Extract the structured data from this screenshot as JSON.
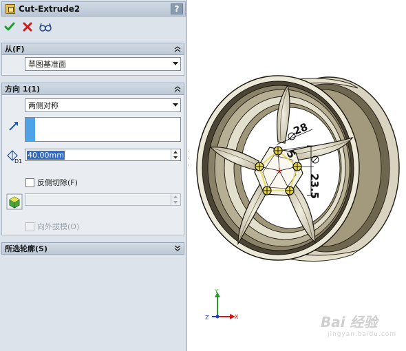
{
  "feature": {
    "title": "Cut-Extrude2",
    "help_label": "?"
  },
  "actions": [
    {
      "name": "ok",
      "icon": "check-icon",
      "color": "#1e9e2a"
    },
    {
      "name": "cancel",
      "icon": "x-icon",
      "color": "#d01818"
    },
    {
      "name": "detailed-preview",
      "icon": "glasses-icon",
      "color": "#2a4a8a"
    }
  ],
  "from": {
    "header": "从(F)",
    "value": "草图基准面"
  },
  "direction1": {
    "header": "方向 1(1)",
    "end_condition": "两侧对称",
    "depth_value": "40.00mm",
    "depth_label": "D1",
    "flip_side": "反侧切除(F)",
    "draft_outward": "向外拔模(O)"
  },
  "selected_contours": {
    "header": "所选轮廓(S)"
  },
  "sketch": {
    "dim_diameter": "28",
    "dim_radius": "5",
    "dim_length": "23.5"
  },
  "triad": {
    "x": "X",
    "y": "Y",
    "z": "Z"
  },
  "watermark": {
    "brand": "Bai 经验",
    "url": "jingyan.baidu.com"
  },
  "colors": {
    "panel_bg": "#dde3ea",
    "selection_blue": "#3169c6",
    "sketch_yellow": "#e8d84a",
    "dimension_black": "#111111"
  }
}
